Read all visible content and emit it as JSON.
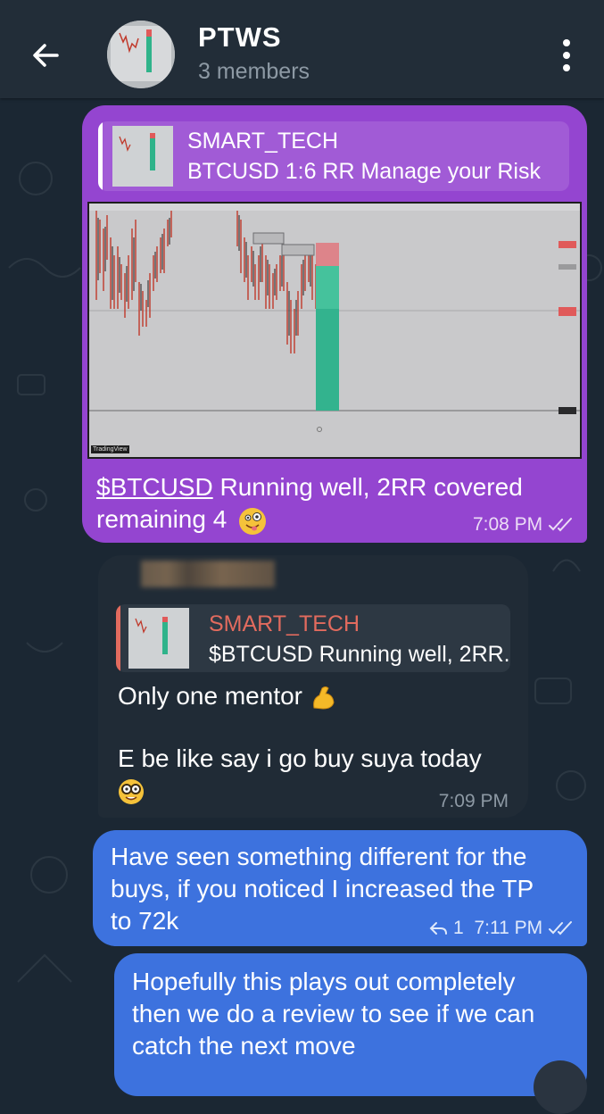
{
  "header": {
    "title": "PTWS",
    "subtitle": "3 members"
  },
  "messages": [
    {
      "reply_to": {
        "author": "SMART_TECH",
        "text": "BTCUSD 1:6 RR Manage your Risk"
      },
      "image_watermark": "TradingView",
      "text_link": "$BTCUSD",
      "text_line1_rest": " Running well, 2RR covered",
      "text_line2": "remaining 4",
      "time": "7:08 PM"
    },
    {
      "reply_to": {
        "author": "SMART_TECH",
        "text": "$BTCUSD Running well, 2RR..."
      },
      "text_line1": "Only one mentor",
      "text_line2": "E be like say i go buy suya today",
      "time": "7:09 PM"
    },
    {
      "text_lines": [
        "Have seen something different for the",
        "buys, if you noticed I increased the TP",
        "to 72k"
      ],
      "replies_count": "1",
      "time": "7:11 PM"
    },
    {
      "text_lines": [
        "Hopefully this plays out completely",
        "then we do a review to see if we can",
        "catch the next move"
      ]
    }
  ],
  "colors": {
    "header_bg": "#222d38",
    "chat_bg": "#1b2733",
    "purple_bubble": "#9445d0",
    "blue_bubble": "#3d72de",
    "incoming_bubble": "#202b36",
    "reply_name_incoming": "#e26b5e"
  },
  "icons": [
    "back-arrow-icon",
    "more-vert-icon",
    "double-check-icon",
    "reply-arrow-icon"
  ]
}
